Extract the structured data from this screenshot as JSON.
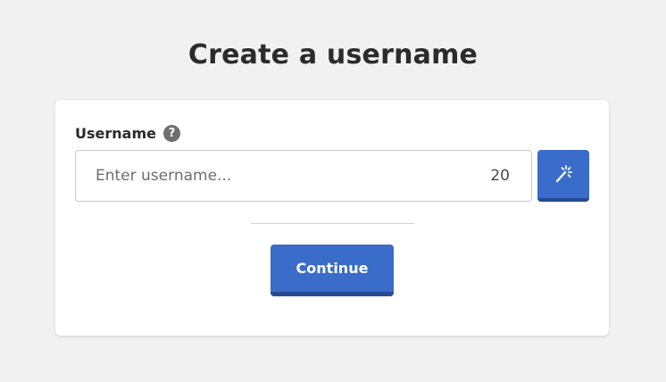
{
  "page": {
    "title": "Create a username"
  },
  "form": {
    "username_label": "Username",
    "help_icon_glyph": "?",
    "username_input": {
      "value": "",
      "placeholder": "Enter username..."
    },
    "char_count": "20",
    "generate_button_icon": "magic-wand-icon",
    "continue_label": "Continue"
  },
  "colors": {
    "background": "#f1f1f1",
    "card": "#ffffff",
    "accent": "#3a6cc9",
    "accent_shadow": "#264a93",
    "title_text": "#2b2b2b",
    "help_icon_bg": "#6f6f6f"
  }
}
